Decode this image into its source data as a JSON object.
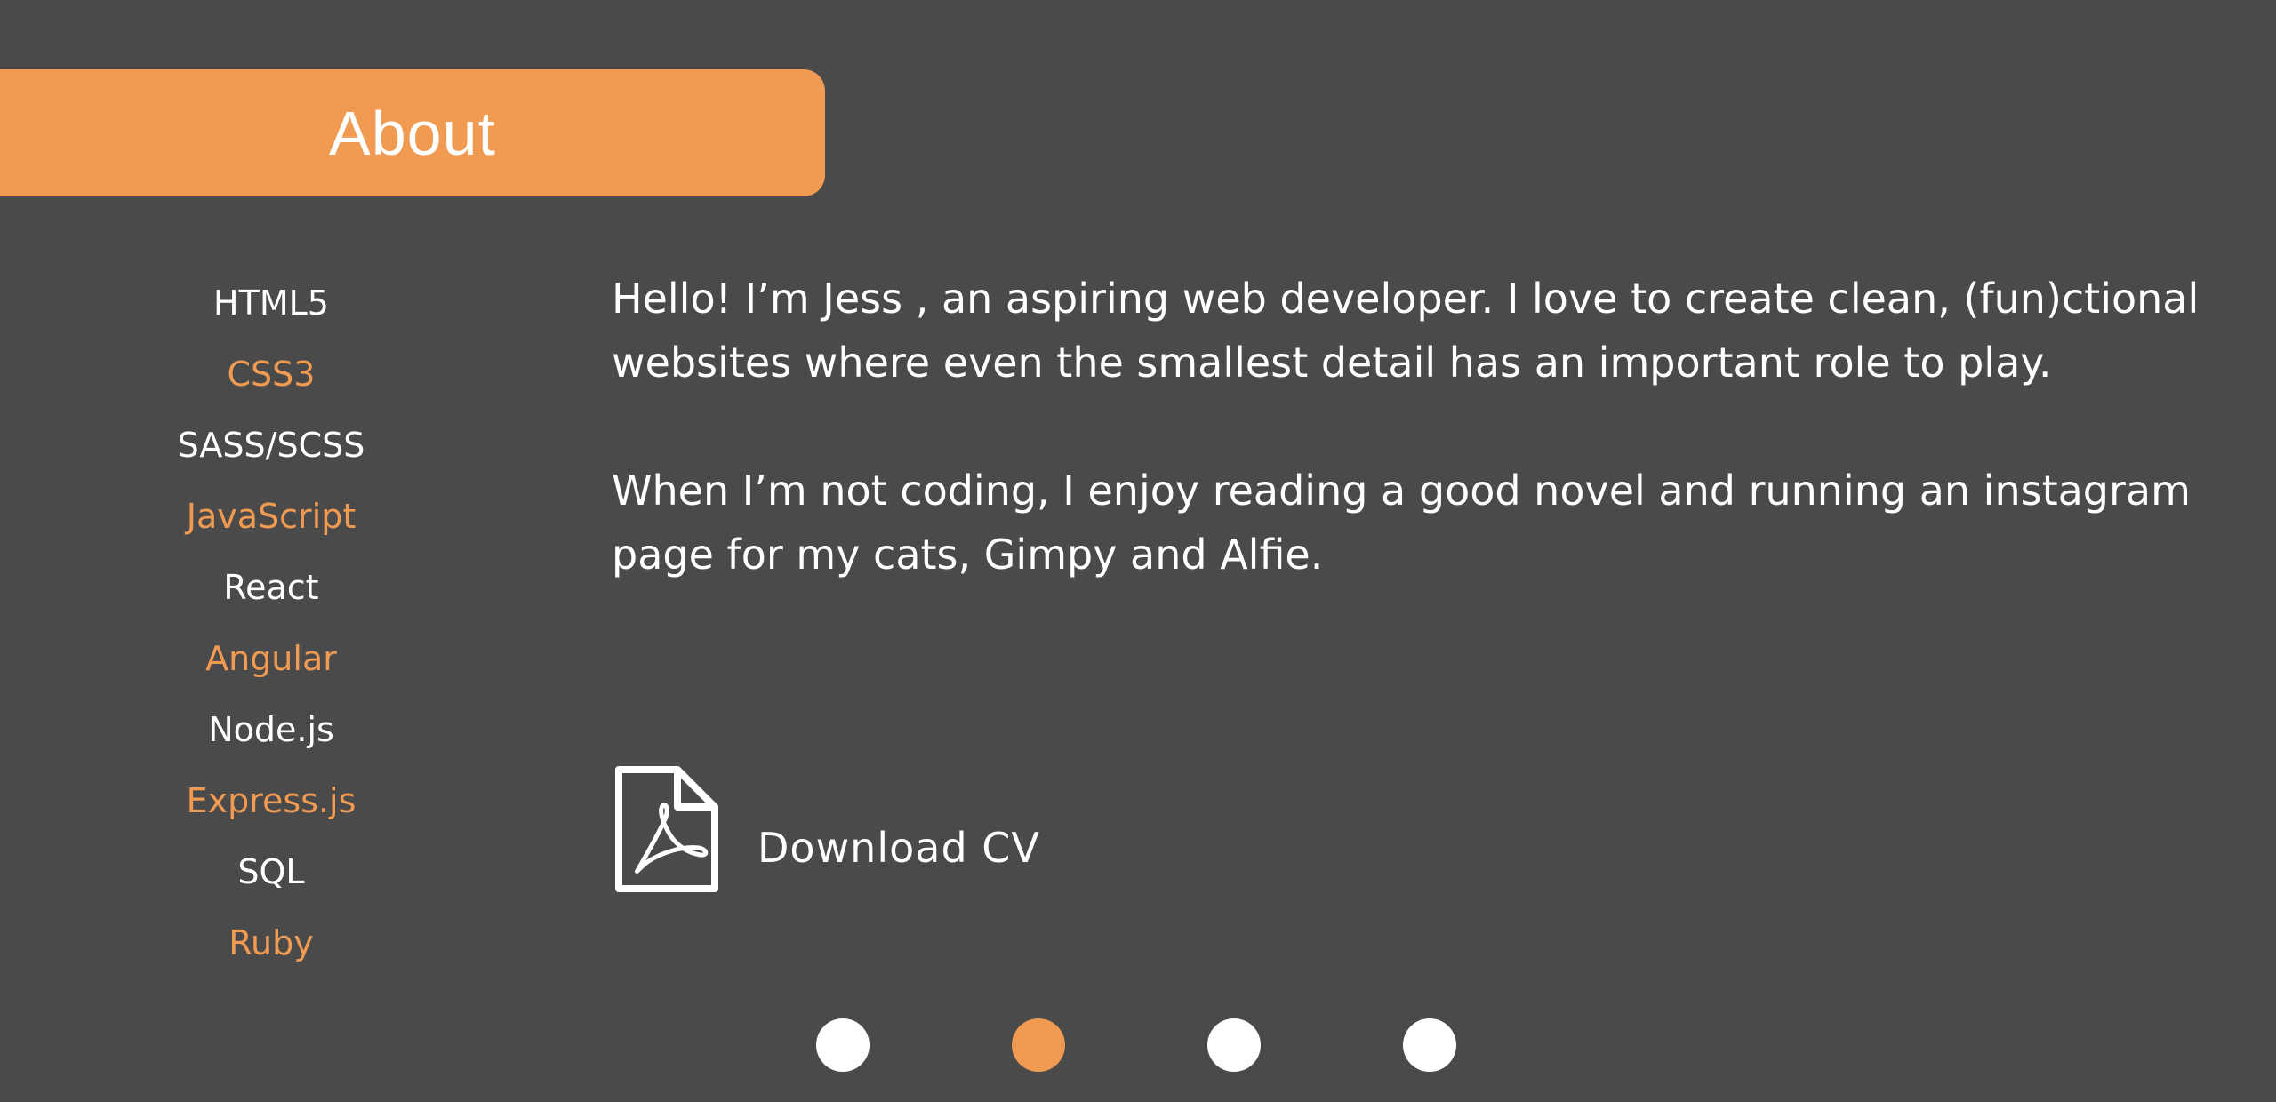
{
  "header": {
    "title": "About"
  },
  "skills": [
    "HTML5",
    "CSS3",
    "SASS/SCSS",
    "JavaScript",
    "React",
    "Angular",
    "Node.js",
    "Express.js",
    "SQL",
    "Ruby"
  ],
  "bio": {
    "paragraph1": "Hello! I’m Jess , an aspiring web developer. I love to create clean, (fun)ctional websites where even the smallest detail has an important role to play.",
    "paragraph2": "When I’m not coding, I enjoy reading a good novel and running an instagram page for my cats, Gimpy and Alfie."
  },
  "cv": {
    "label": "Download CV",
    "icon": "pdf-file-icon"
  },
  "pagination": {
    "count": 4,
    "active_index": 1
  },
  "colors": {
    "background": "#4a4a4a",
    "accent": "#f09a52",
    "text": "#ffffff"
  }
}
